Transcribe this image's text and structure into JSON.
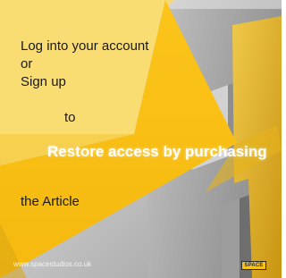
{
  "prompt": {
    "login_label": "Log into your account",
    "or_label": "or",
    "signup_label": "Sign up",
    "to_label": "to",
    "restore_label": "Restore access by purchasing",
    "article_label": "the Article"
  },
  "footer": {
    "site_url": "www.spacestudios.co.uk",
    "logo_text": "SPACE"
  },
  "colors": {
    "accent_yellow": "#f6c31c",
    "text_dark": "#1a1a1a",
    "text_light": "#ffffff"
  }
}
